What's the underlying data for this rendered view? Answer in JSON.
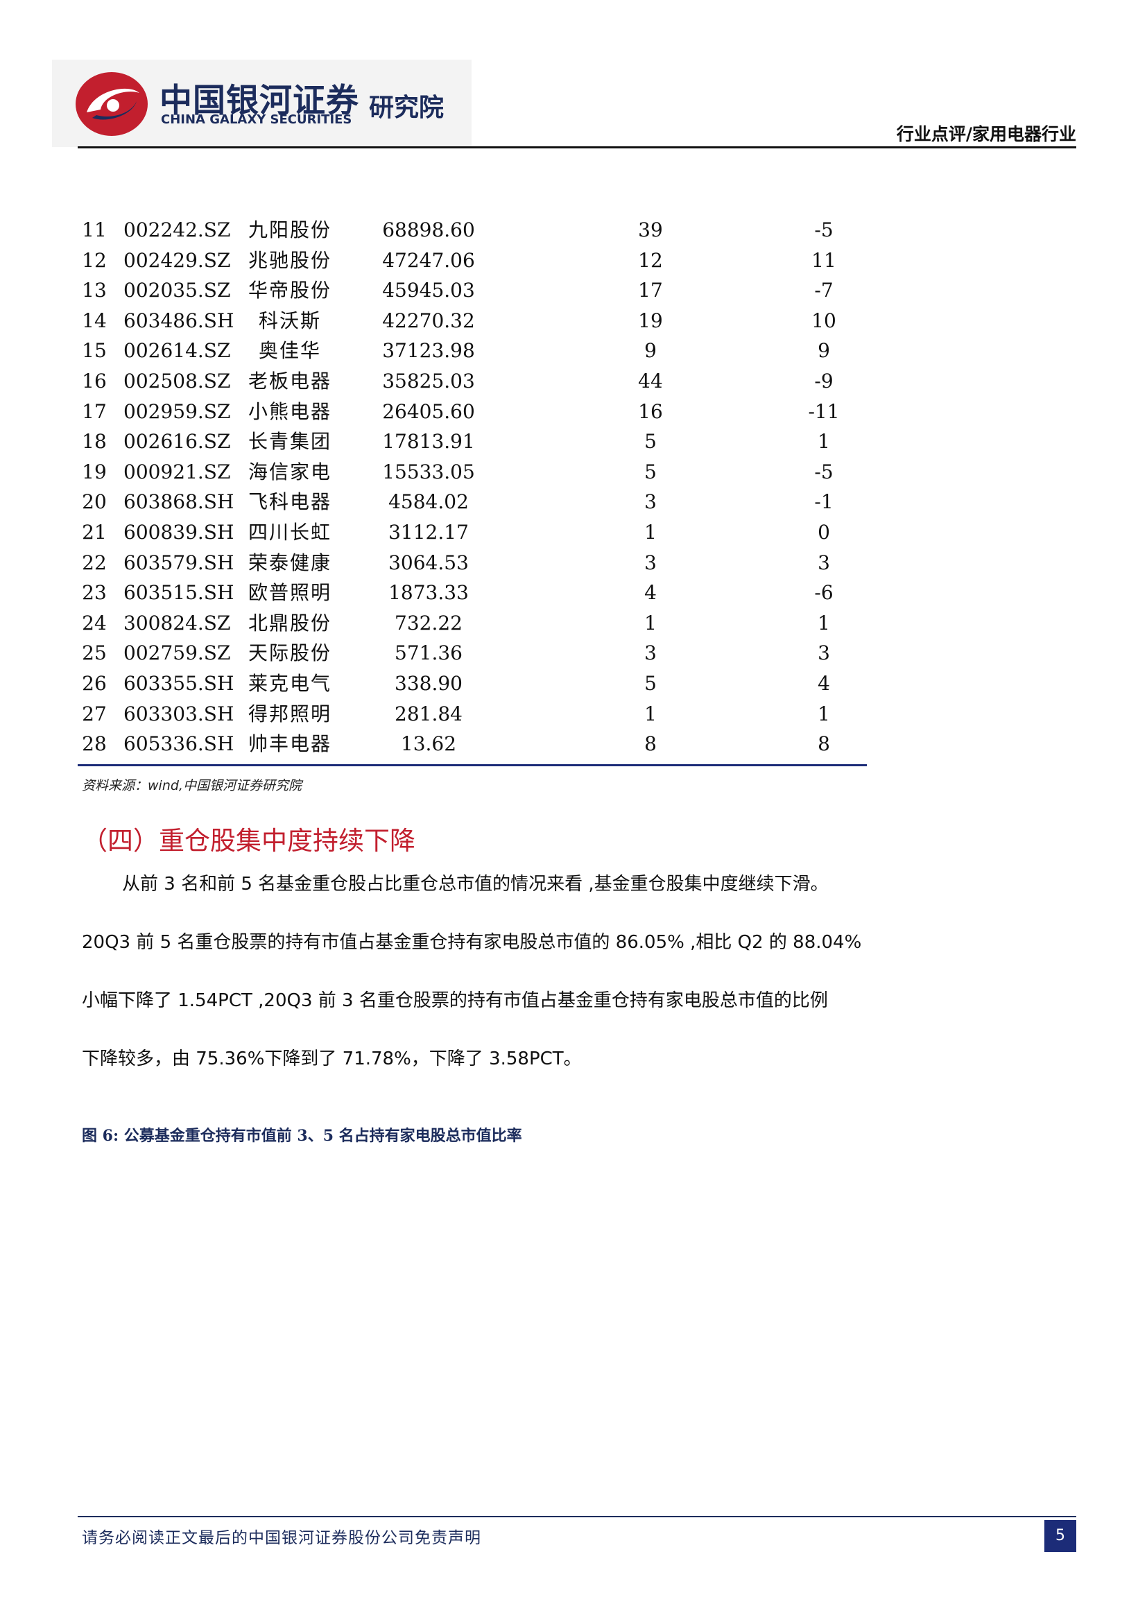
{
  "header": {
    "logo_cn": "中国银河证券",
    "logo_en": "CHINA GALAXY SECURITIES",
    "logo_sub": "研究院",
    "category": "行业点评/家用电器行业"
  },
  "table": {
    "rows": [
      {
        "no": "11",
        "code": "002242.SZ",
        "name": "九阳股份",
        "value": "68898.60",
        "count": "39",
        "change": "-5"
      },
      {
        "no": "12",
        "code": "002429.SZ",
        "name": "兆驰股份",
        "value": "47247.06",
        "count": "12",
        "change": "11"
      },
      {
        "no": "13",
        "code": "002035.SZ",
        "name": "华帝股份",
        "value": "45945.03",
        "count": "17",
        "change": "-7"
      },
      {
        "no": "14",
        "code": "603486.SH",
        "name": "科沃斯",
        "value": "42270.32",
        "count": "19",
        "change": "10"
      },
      {
        "no": "15",
        "code": "002614.SZ",
        "name": "奥佳华",
        "value": "37123.98",
        "count": "9",
        "change": "9"
      },
      {
        "no": "16",
        "code": "002508.SZ",
        "name": "老板电器",
        "value": "35825.03",
        "count": "44",
        "change": "-9"
      },
      {
        "no": "17",
        "code": "002959.SZ",
        "name": "小熊电器",
        "value": "26405.60",
        "count": "16",
        "change": "-11"
      },
      {
        "no": "18",
        "code": "002616.SZ",
        "name": "长青集团",
        "value": "17813.91",
        "count": "5",
        "change": "1"
      },
      {
        "no": "19",
        "code": "000921.SZ",
        "name": "海信家电",
        "value": "15533.05",
        "count": "5",
        "change": "-5"
      },
      {
        "no": "20",
        "code": "603868.SH",
        "name": "飞科电器",
        "value": "4584.02",
        "count": "3",
        "change": "-1"
      },
      {
        "no": "21",
        "code": "600839.SH",
        "name": "四川长虹",
        "value": "3112.17",
        "count": "1",
        "change": "0"
      },
      {
        "no": "22",
        "code": "603579.SH",
        "name": "荣泰健康",
        "value": "3064.53",
        "count": "3",
        "change": "3"
      },
      {
        "no": "23",
        "code": "603515.SH",
        "name": "欧普照明",
        "value": "1873.33",
        "count": "4",
        "change": "-6"
      },
      {
        "no": "24",
        "code": "300824.SZ",
        "name": "北鼎股份",
        "value": "732.22",
        "count": "1",
        "change": "1"
      },
      {
        "no": "25",
        "code": "002759.SZ",
        "name": "天际股份",
        "value": "571.36",
        "count": "3",
        "change": "3"
      },
      {
        "no": "26",
        "code": "603355.SH",
        "name": "莱克电气",
        "value": "338.90",
        "count": "5",
        "change": "4"
      },
      {
        "no": "27",
        "code": "603303.SH",
        "name": "得邦照明",
        "value": "281.84",
        "count": "1",
        "change": "1"
      },
      {
        "no": "28",
        "code": "605336.SH",
        "name": "帅丰电器",
        "value": "13.62",
        "count": "8",
        "change": "8"
      }
    ],
    "source": "资料来源：wind,中国银河证券研究院"
  },
  "section": {
    "title": "（四）重仓股集中度持续下降",
    "lines": [
      "从前 3 名和前 5 名基金重仓股占比重仓总市值的情况来看 ,基金重仓股集中度继续下滑。",
      "20Q3 前 5 名重仓股票的持有市值占基金重仓持有家电股总市值的 86.05% ,相比 Q2 的 88.04%",
      "小幅下降了 1.54PCT ,20Q3 前 3 名重仓股票的持有市值占基金重仓持有家电股总市值的比例",
      "下降较多，由 75.36%下降到了 71.78%，下降了 3.58PCT。"
    ],
    "figure_caption": "图 6: 公募基金重仓持有市值前 3、5 名占持有家电股总市值比率"
  },
  "footer": {
    "disclaimer": "请务必阅读正文最后的中国银河证券股份公司免责声明",
    "page": "5"
  },
  "colors": {
    "brand_navy": "#1c2c5c",
    "brand_red": "#c21f2e",
    "rule_blue": "#1c2c78"
  }
}
